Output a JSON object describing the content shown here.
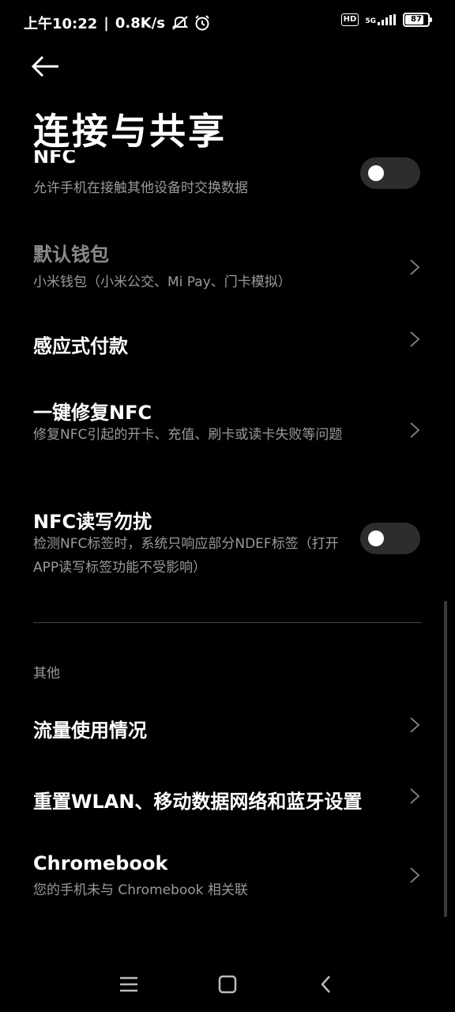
{
  "status_bar": {
    "time": "上午10:22",
    "net_speed": "0.8K/s",
    "network": "5G",
    "hd": "HD",
    "battery": 87
  },
  "page": {
    "title": "连接与共享"
  },
  "items": [
    {
      "title": "NFC",
      "subtitle": "允许手机在接触其他设备时交换数据",
      "control": "toggle",
      "on": false
    },
    {
      "title": "默认钱包",
      "subtitle": "小米钱包（小米公交、Mi Pay、门卡模拟）",
      "control": "chevron",
      "disabled": true
    },
    {
      "title": "感应式付款",
      "control": "chevron"
    },
    {
      "title": "一键修复NFC",
      "subtitle": "修复NFC引起的开卡、充值、刷卡或读卡失败等问题",
      "control": "chevron"
    },
    {
      "title": "NFC读写勿扰",
      "subtitle": "检测NFC标签时，系统只响应部分NDEF标签（打开APP读写标签功能不受影响）",
      "control": "toggle",
      "on": false
    }
  ],
  "section_other": {
    "label": "其他"
  },
  "other_items": [
    {
      "title": "流量使用情况",
      "control": "chevron"
    },
    {
      "title": "重置WLAN、移动数据网络和蓝牙设置",
      "control": "chevron"
    },
    {
      "title": "Chromebook",
      "subtitle": "您的手机未与 Chromebook 相关联",
      "control": "chevron"
    }
  ],
  "icons": {
    "back": "arrow-left-icon",
    "chevron": "chevron-right-icon",
    "nav_menu": "menu-icon",
    "nav_home": "square-icon",
    "nav_back": "chevron-left-icon"
  }
}
